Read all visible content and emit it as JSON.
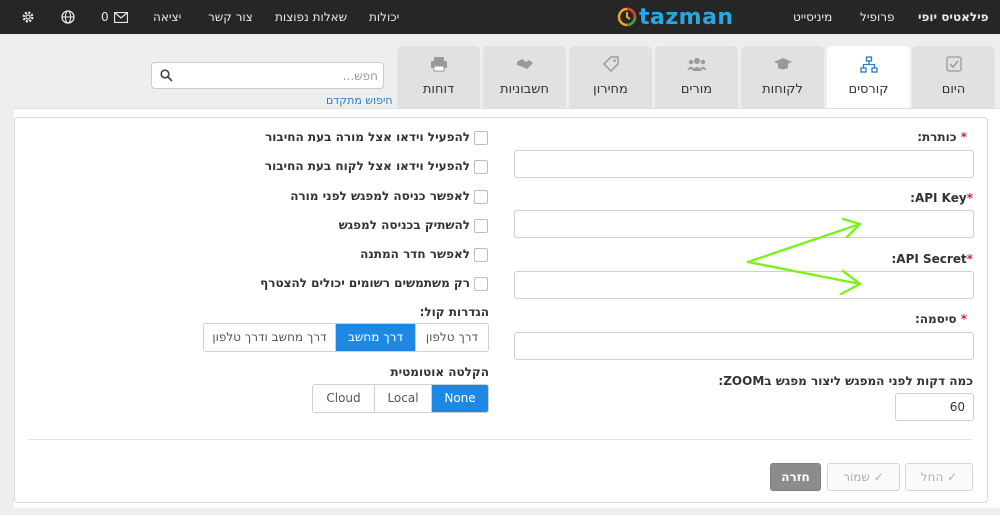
{
  "topbar": {
    "user_name": "פילאטיס יופי",
    "profile": "פרופיל",
    "ministeps": "מיניסייט",
    "brand": "tazman",
    "capabilities": "יכולות",
    "faq": "שאלות נפוצות",
    "contact": "צור קשר",
    "logout": "יציאה",
    "messages_count": "0"
  },
  "tabs": [
    {
      "label": "היום",
      "icon": "checkbox-icon"
    },
    {
      "label": "קורסים",
      "icon": "sitemap-icon"
    },
    {
      "label": "לקוחות",
      "icon": "graduation-cap-icon"
    },
    {
      "label": "מורים",
      "icon": "users-icon"
    },
    {
      "label": "מחירון",
      "icon": "tag-icon"
    },
    {
      "label": "חשבוניות",
      "icon": "handshake-icon"
    },
    {
      "label": "דוחות",
      "icon": "printer-icon"
    }
  ],
  "search": {
    "placeholder": "חפש...",
    "advanced_link": "חיפוש מתקדם"
  },
  "form": {
    "title_label": "כותרת:",
    "api_key_label": "API Key:",
    "api_secret_label": "API Secret:",
    "password_label": "סיסמה:",
    "title_value": "",
    "api_key_value": "",
    "api_secret_value": "",
    "password_value": "",
    "minutes_label": "כמה דקות לפני המפגש ליצור מפגש בZOOM:",
    "minutes_value": "60",
    "required_mark": "*"
  },
  "options": {
    "checkboxes": [
      "להפעיל וידאו אצל מורה בעת החיבור",
      "להפעיל וידאו אצל לקוח בעת החיבור",
      "לאפשר כניסה למפגש לפני מורה",
      "להשתיק בכניסה למפגש",
      "לאפשר חדר המתנה",
      "רק משתמשים רשומים יכולים להצטרף"
    ],
    "audio_label": "הגדרות קול:",
    "audio_options": [
      "דרך טלפון",
      "דרך מחשב",
      "דרך מחשב ודרך טלפון"
    ],
    "audio_selected": "דרך מחשב",
    "recording_label": "הקלטה אוטומטית",
    "recording_options": [
      "None",
      "Local",
      "Cloud"
    ],
    "recording_selected": "None"
  },
  "actions": {
    "apply": "החל",
    "save": "שמור",
    "back": "חזרה"
  },
  "colors": {
    "accent": "#1e88e5",
    "annotation": "#7bf21b",
    "topbar": "#262626"
  }
}
